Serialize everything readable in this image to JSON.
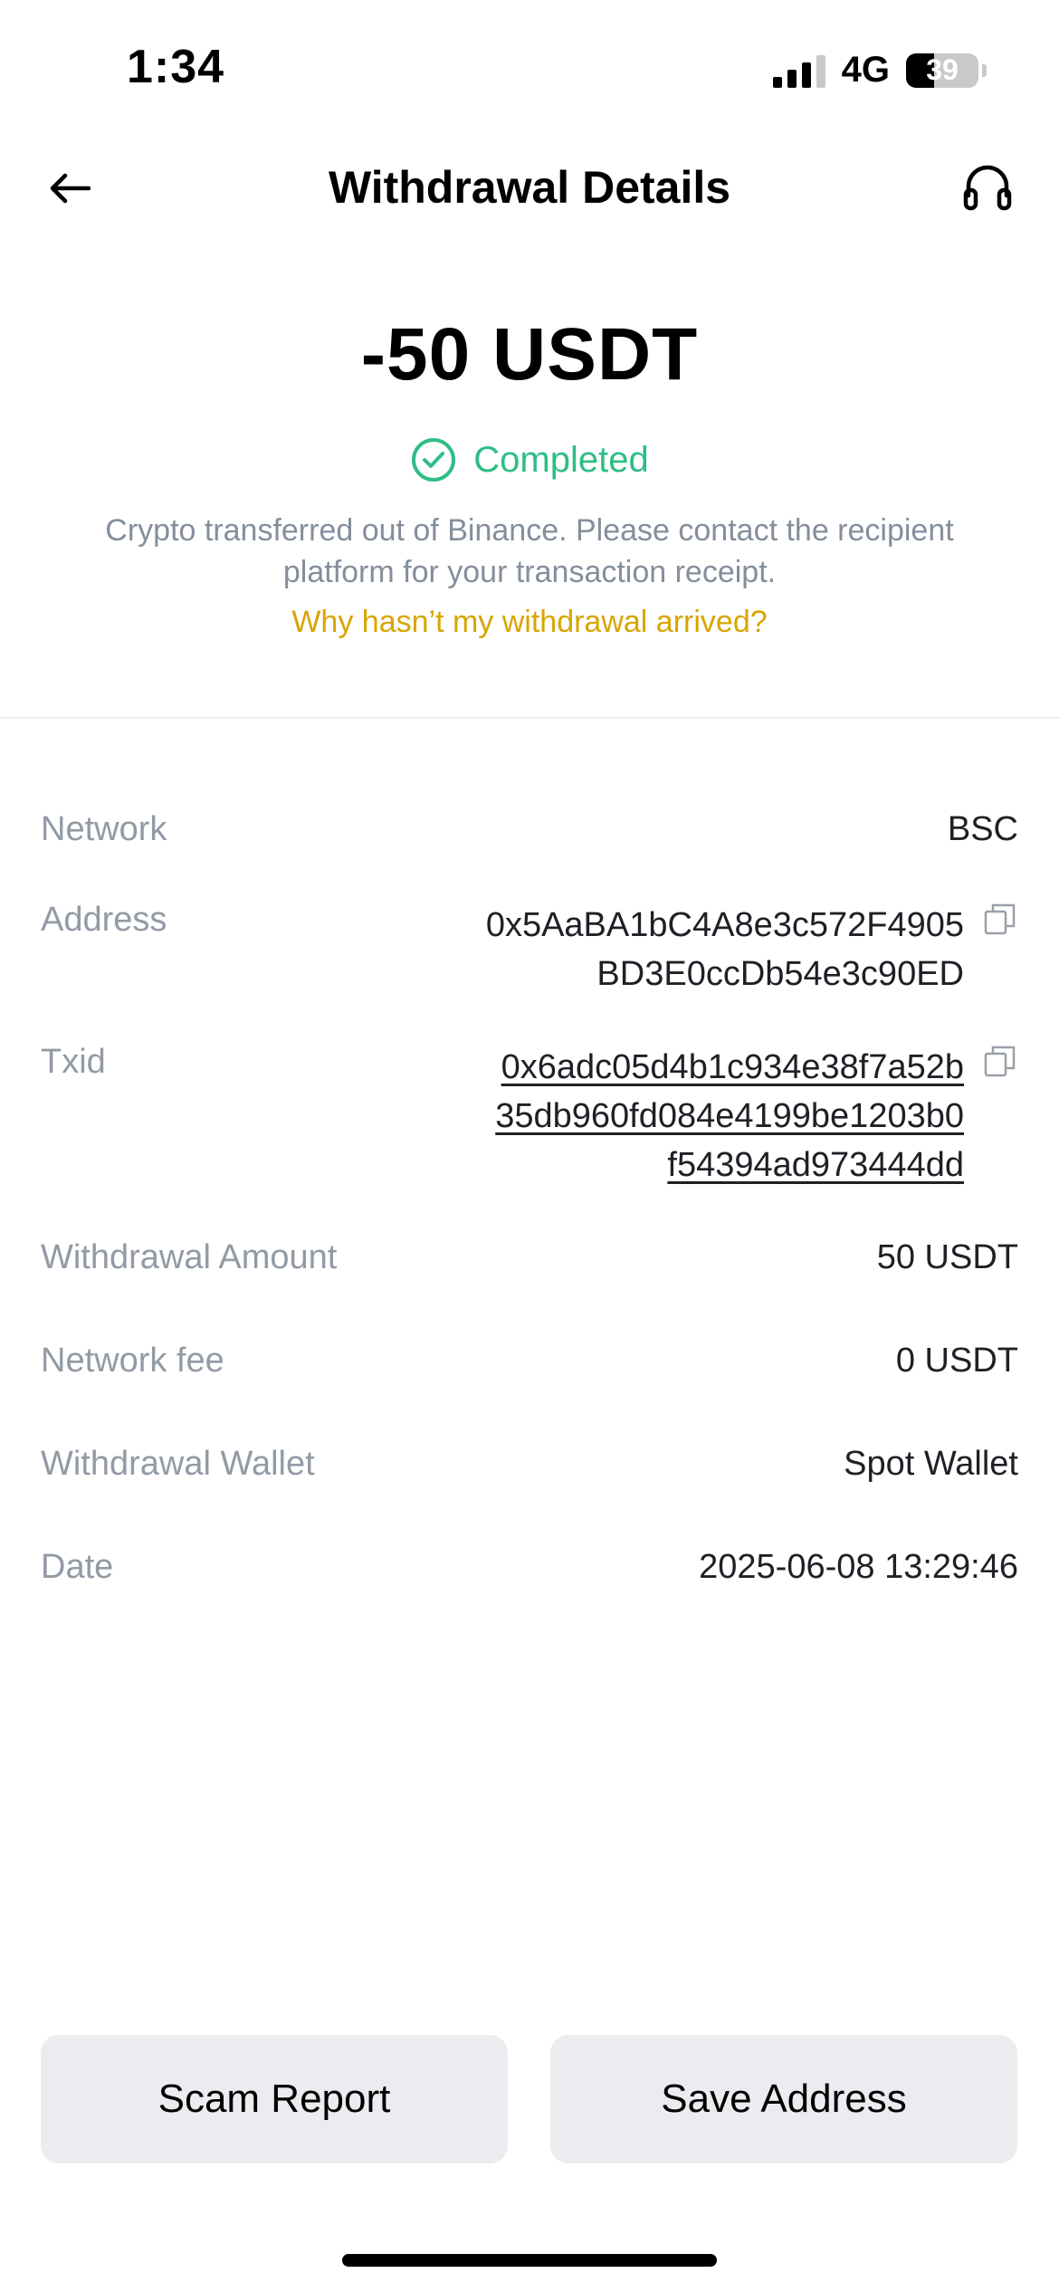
{
  "status_bar": {
    "time": "1:34",
    "network": "4G",
    "battery_level": "39",
    "battery_fraction": 0.39
  },
  "header": {
    "title": "Withdrawal Details",
    "back_icon": "arrow-left-icon",
    "support_icon": "headset-icon"
  },
  "summary": {
    "amount": "-50 USDT",
    "status": "Completed",
    "status_color": "#2ebd85",
    "info_line1": "Crypto transferred out of Binance. Please contact the recipient",
    "info_line2": "platform for your transaction receipt.",
    "help_link": "Why hasn’t my withdrawal arrived?",
    "link_color": "#d8a500"
  },
  "details": {
    "network": {
      "label": "Network",
      "value": "BSC"
    },
    "address": {
      "label": "Address",
      "lines": [
        "0x5AaBA1bC4A8e3c572F4905",
        "BD3E0ccDb54e3c90ED"
      ]
    },
    "txid": {
      "label": "Txid",
      "lines": [
        "0x6adc05d4b1c934e38f7a52b",
        "35db960fd084e4199be1203b0",
        "f54394ad973444dd"
      ]
    },
    "withdrawal_amount": {
      "label": "Withdrawal Amount",
      "value": "50 USDT"
    },
    "network_fee": {
      "label": "Network fee",
      "value": "0 USDT"
    },
    "withdrawal_wallet": {
      "label": "Withdrawal Wallet",
      "value": "Spot Wallet"
    },
    "date": {
      "label": "Date",
      "value": "2025-06-08 13:29:46"
    }
  },
  "actions": {
    "scam_report": "Scam Report",
    "save_address": "Save Address"
  }
}
